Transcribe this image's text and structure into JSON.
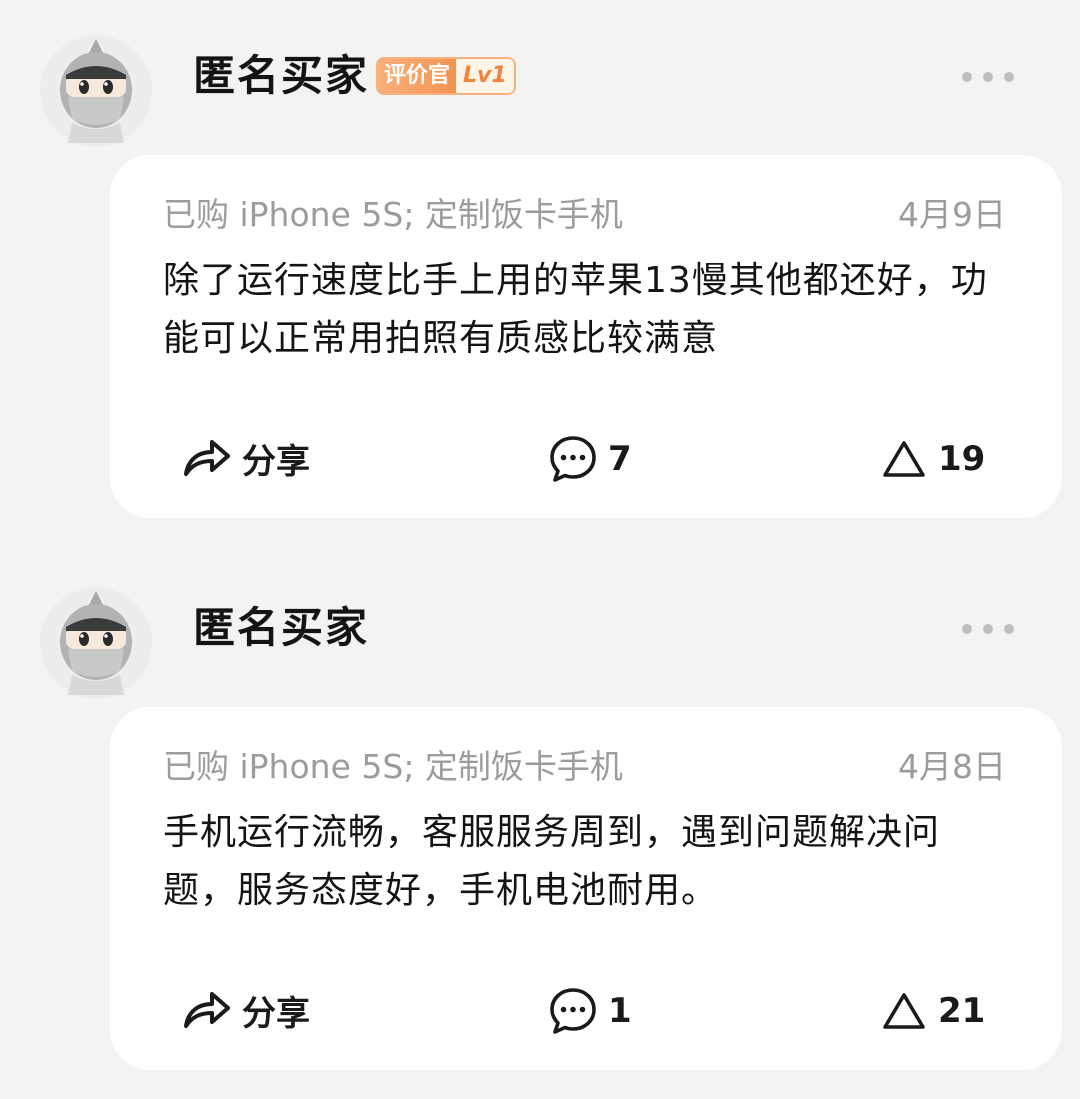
{
  "reviews": [
    {
      "username": "匿名买家",
      "badge": {
        "title": "评价官",
        "level": "Lv1"
      },
      "purchase": "已购 iPhone 5S; 定制饭卡手机",
      "date": "4月9日",
      "content": "除了运行速度比手上用的苹果13慢其他都还好，功能可以正常用拍照有质感比较满意",
      "share_label": "分享",
      "comment_count": "7",
      "like_count": "19"
    },
    {
      "username": "匿名买家",
      "purchase": "已购 iPhone 5S; 定制饭卡手机",
      "date": "4月8日",
      "content": "手机运行流畅，客服服务周到，遇到问题解决问题，服务态度好，手机电池耐用。",
      "share_label": "分享",
      "comment_count": "1",
      "like_count": "21"
    }
  ],
  "icons": {
    "avatar": "anonymous-ninja-avatar-icon",
    "more": "more-dots-icon",
    "share": "share-arrow-icon",
    "comment": "comment-bubble-icon",
    "like": "triangle-like-icon"
  },
  "colors": {
    "background": "#f3f3f3",
    "card": "#ffffff",
    "badge_accent": "#f4924f",
    "muted_text": "#9c9c9c"
  }
}
